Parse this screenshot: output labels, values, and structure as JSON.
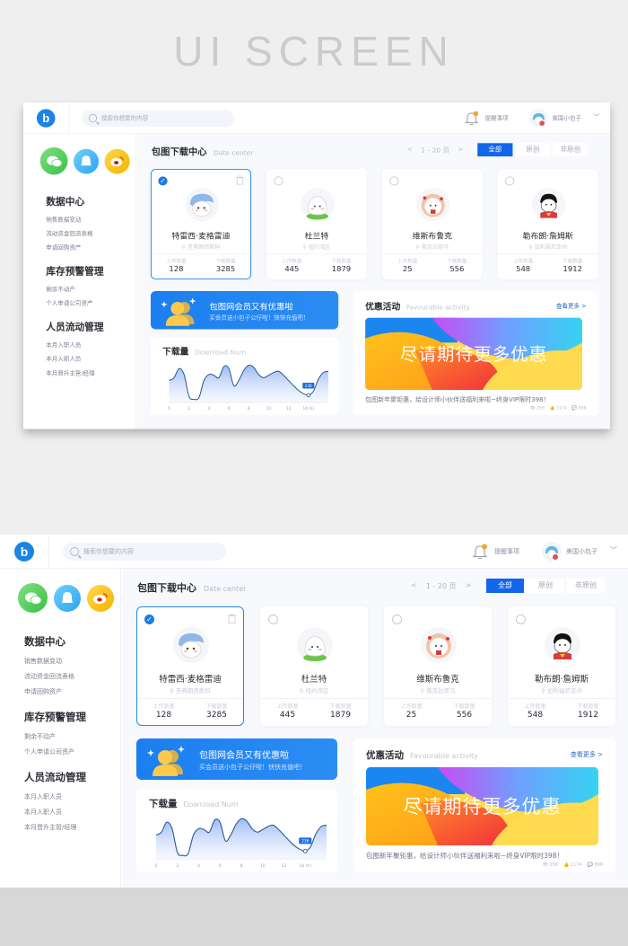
{
  "page": {
    "hero_title": "UI SCREEN"
  },
  "topbar": {
    "logo": "b",
    "search_placeholder": "搜索你想要的内容",
    "reminder_label": "提醒事项",
    "user_name": "美国小包子",
    "user_chevron": "﹀"
  },
  "sidebar": {
    "groups": [
      {
        "title": "数据中心",
        "items": [
          "销售数据变动",
          "流动资金回流表格",
          "申请回购资产"
        ]
      },
      {
        "title": "库存预警管理",
        "items": [
          "剩余不动产",
          "个人申请公司资产"
        ]
      },
      {
        "title": "人员流动管理",
        "items": [
          "本月入职人员",
          "本月入职人员",
          "本月晋升主管/经理"
        ]
      }
    ]
  },
  "download_center": {
    "title_cn": "包图下载中心",
    "title_en": "Date center",
    "pager": {
      "prev": "<",
      "range": "1 - 20 页",
      "next": ">"
    },
    "tabs": [
      {
        "label": "全部",
        "active": true
      },
      {
        "label": "原创",
        "active": false
      },
      {
        "label": "非原创",
        "active": false
      }
    ],
    "stat_labels": {
      "upload": "上传数量",
      "download": "下载数量"
    },
    "cards": [
      {
        "name": "特雷西·麦格雷迪",
        "location": "圣弗朗西斯科",
        "uploads": "128",
        "downloads": "3285",
        "selected": true
      },
      {
        "name": "杜兰特",
        "location": "纽约湾区",
        "uploads": "445",
        "downloads": "1879",
        "selected": false
      },
      {
        "name": "维斯布鲁克",
        "location": "俄克拉荷马",
        "uploads": "25",
        "downloads": "556",
        "selected": false
      },
      {
        "name": "勒布朗·詹姆斯",
        "location": "加利福尼亚州",
        "uploads": "548",
        "downloads": "1912",
        "selected": false
      }
    ]
  },
  "promo": {
    "title": "包图网会员又有优惠啦",
    "subtitle": "买会员送小包子公仔啦！快快充值吧！"
  },
  "download_chart": {
    "title_cn": "下载量",
    "title_en": "Download Num",
    "highlight_label": "236"
  },
  "chart_data": {
    "type": "area",
    "title": "下载量 Download Num",
    "xlabel": "(h)",
    "ylabel": "",
    "x_ticks": [
      "0",
      "2",
      "4",
      "6",
      "8",
      "10",
      "12",
      "14 (h)"
    ],
    "xlim": [
      0,
      16
    ],
    "ylim": [
      0,
      100
    ],
    "x": [
      0,
      0.5,
      1,
      1.5,
      2,
      2.5,
      3,
      3.5,
      4,
      4.5,
      5,
      5.5,
      6,
      6.5,
      7,
      7.5,
      8,
      8.5,
      9,
      9.5,
      10,
      10.5,
      11,
      11.5,
      12,
      12.5,
      13,
      13.5,
      14,
      14.5,
      15,
      15.5,
      16
    ],
    "values": [
      55,
      62,
      85,
      70,
      15,
      8,
      12,
      55,
      70,
      68,
      62,
      90,
      85,
      42,
      55,
      80,
      93,
      88,
      70,
      62,
      68,
      75,
      78,
      68,
      55,
      42,
      30,
      22,
      18,
      28,
      58,
      75,
      78
    ],
    "highlight": {
      "x": 14,
      "label": "236"
    },
    "grid": false,
    "legend": "none"
  },
  "activity": {
    "title_cn": "优惠活动",
    "title_en": "Favourable activity",
    "more_label": "查看更多 >",
    "banner_text": "尽请期待更多优惠",
    "description": "包图新年聚钜惠，给设计师小伙伴送福利来啦~终身VIP限时398！",
    "views": "256",
    "likes": "1174",
    "comments": "898"
  }
}
